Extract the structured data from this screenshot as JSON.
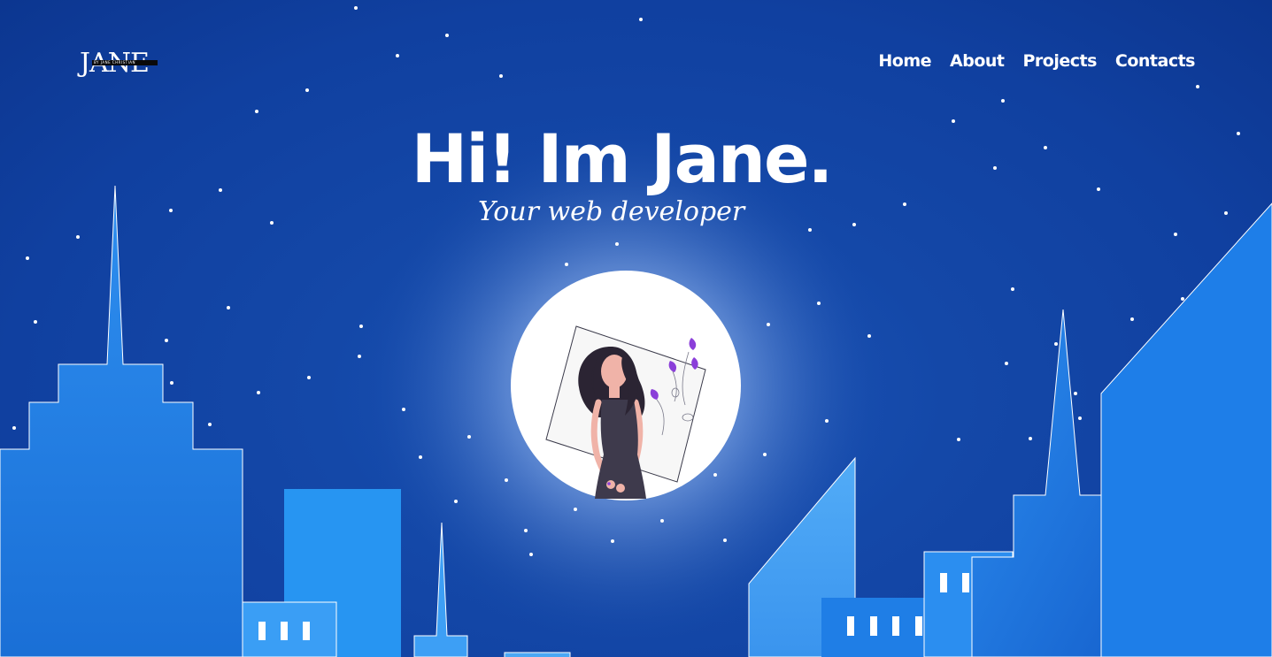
{
  "logo": {
    "text": "JANE",
    "subtext": "BY JANE CHRISTIAN"
  },
  "nav": [
    {
      "label": "Home"
    },
    {
      "label": "About"
    },
    {
      "label": "Projects"
    },
    {
      "label": "Contacts"
    }
  ],
  "hero": {
    "title": "Hi! Im Jane.",
    "subtitle": "Your web developer"
  },
  "colors": {
    "sky": "#1448a8",
    "building": "#2a8df0",
    "building_light": "#4aa8f5",
    "moon": "#ffffff",
    "accent_purple": "#8b3fd9"
  }
}
